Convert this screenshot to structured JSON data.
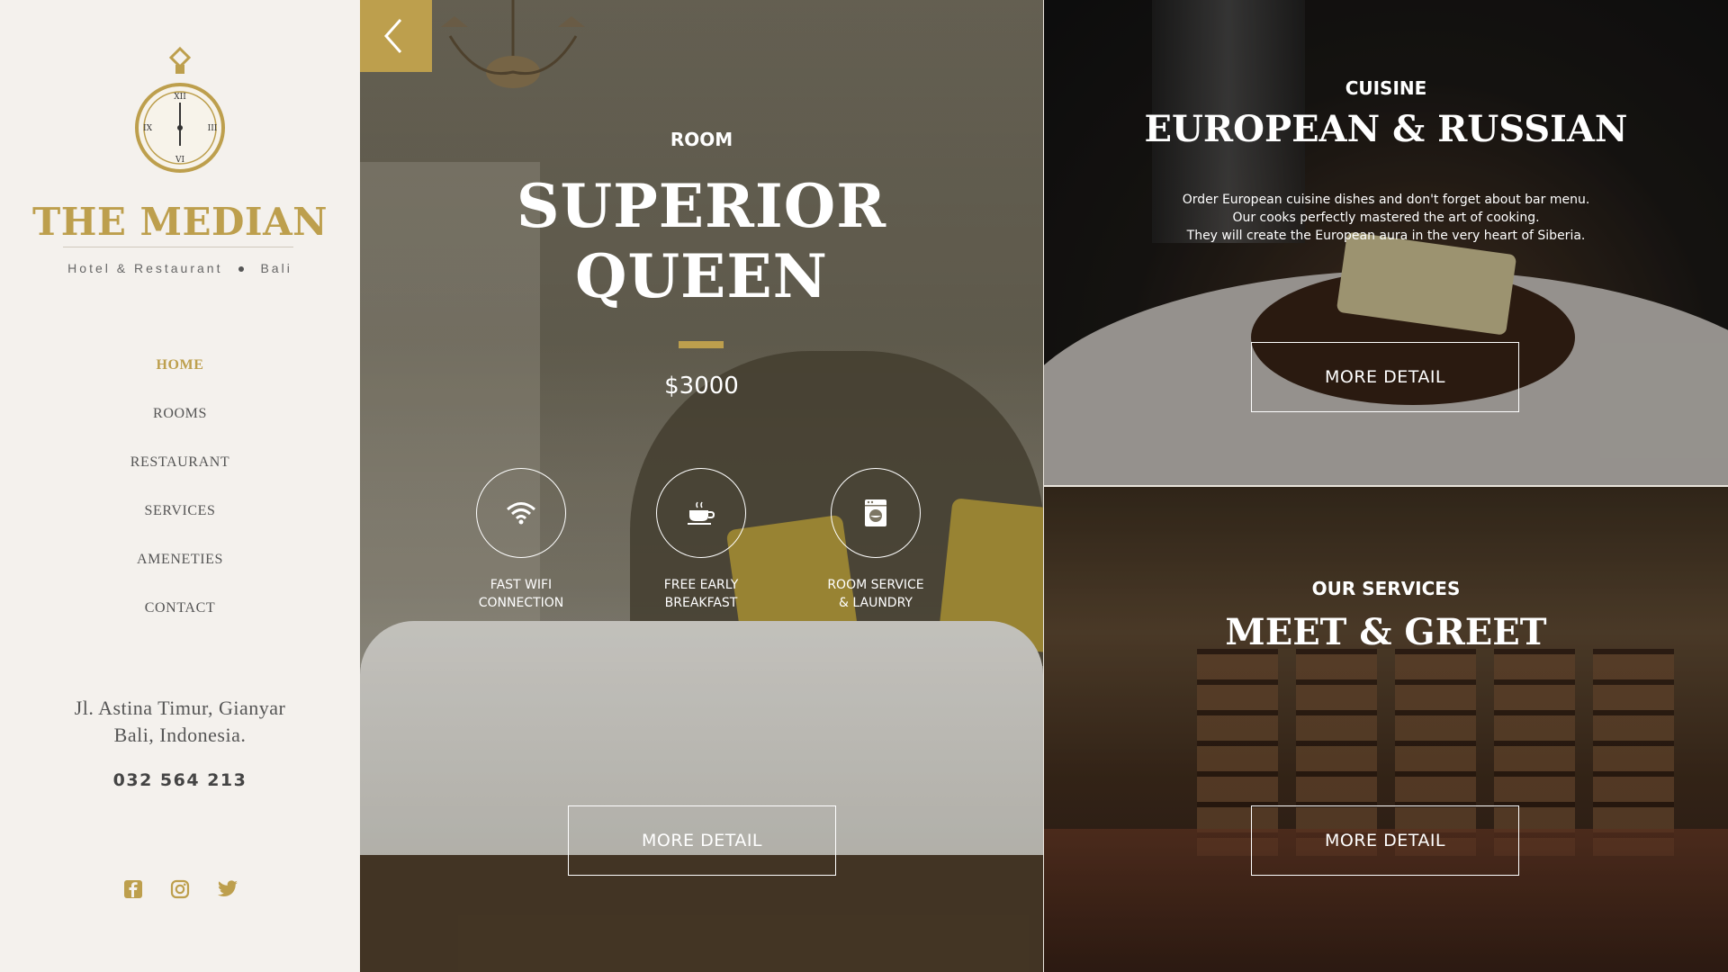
{
  "sidebar": {
    "brand": "THE MEDIAN",
    "tagline_left": "Hotel & Restaurant",
    "tagline_right": "Bali",
    "nav": [
      "HOME",
      "ROOMS",
      "RESTAURANT",
      "SERVICES",
      "AMENETIES",
      "CONTACT"
    ],
    "active_nav": "HOME",
    "address_line1": "Jl. Astina Timur, Gianyar",
    "address_line2": "Bali, Indonesia.",
    "phone": "032 564 213",
    "socials": [
      "facebook-icon",
      "instagram-icon",
      "twitter-icon"
    ]
  },
  "room": {
    "kicker": "ROOM",
    "title_line1": "SUPERIOR",
    "title_line2": "QUEEN",
    "price": "$3000",
    "features": [
      {
        "icon": "wifi-icon",
        "line1": "FAST WIFI",
        "line2": "CONNECTION"
      },
      {
        "icon": "coffee-cup-icon",
        "line1": "FREE EARLY",
        "line2": "BREAKFAST"
      },
      {
        "icon": "washing-machine-icon",
        "line1": "ROOM SERVICE",
        "line2": "& LAUNDRY"
      }
    ],
    "button": "MORE DETAIL"
  },
  "cuisine": {
    "kicker": "CUISINE",
    "title": "EUROPEAN & RUSSIAN",
    "desc_line1": "Order European cuisine dishes and don't forget about bar menu.",
    "desc_line2": "Our cooks perfectly mastered the art of cooking.",
    "desc_line3": "They will create the European aura in the very heart of Siberia.",
    "button": "MORE DETAIL"
  },
  "services": {
    "kicker": "OUR SERVICES",
    "title": "MEET & GREET",
    "button": "MORE DETAIL"
  },
  "colors": {
    "accent": "#bd9f4d",
    "sidebar_bg": "#f4f1ed"
  }
}
